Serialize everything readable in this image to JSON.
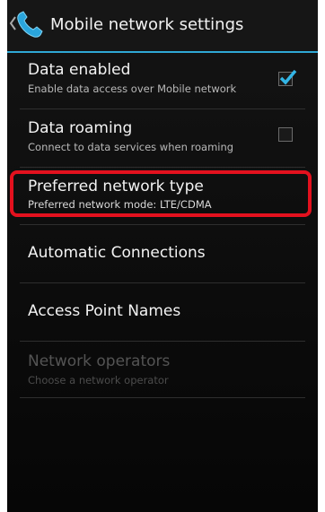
{
  "header": {
    "title": "Mobile network settings"
  },
  "settings": {
    "data_enabled": {
      "title": "Data enabled",
      "summary": "Enable data access over Mobile network",
      "checked": true
    },
    "data_roaming": {
      "title": "Data roaming",
      "summary": "Connect to data services when roaming",
      "checked": false
    },
    "preferred_network": {
      "title": "Preferred network type",
      "summary": "Preferred network mode: LTE/CDMA"
    },
    "automatic_connections": {
      "title": "Automatic Connections"
    },
    "access_point_names": {
      "title": "Access Point Names"
    },
    "network_operators": {
      "title": "Network operators",
      "summary": "Choose a network operator",
      "enabled": false
    }
  },
  "colors": {
    "accent": "#2fa8d5",
    "highlight": "#e3111e"
  },
  "icons": {
    "back": "chevron-left-icon",
    "app": "phone-icon",
    "check": "checkmark-icon"
  }
}
